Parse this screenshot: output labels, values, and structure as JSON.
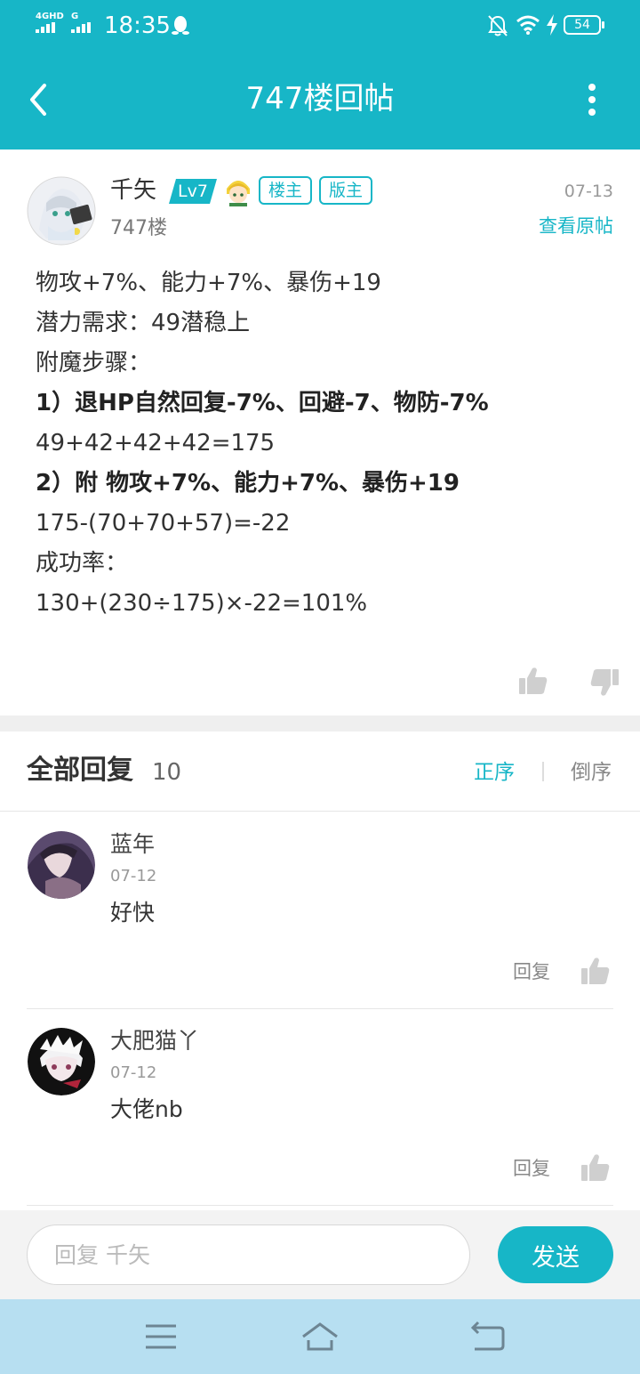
{
  "status_bar": {
    "network_1": "4GHD",
    "network_2": "G",
    "time": "18:35",
    "battery": "54"
  },
  "app_bar": {
    "title": "747楼回帖",
    "back_icon": "chevron-left-icon",
    "more_icon": "more-vertical-icon"
  },
  "post": {
    "author": "千矢",
    "level": "Lv7",
    "tags": [
      "楼主",
      "版主"
    ],
    "floor": "747楼",
    "date": "07-13",
    "view_original": "查看原帖",
    "lines": [
      "物攻+7%、能力+7%、暴伤+19",
      "潜力需求：49潜稳上",
      "附魔步骤：",
      "1）退HP自然回复-7%、回避-7、物防-7%",
      "49+42+42+42=175",
      "2）附 物攻+7%、能力+7%、暴伤+19",
      "175-(70+70+57)=-22",
      "成功率：",
      "130+(230÷175)×-22=101%"
    ]
  },
  "replies_header": {
    "title": "全部回复",
    "count": "10",
    "sort_asc": "正序",
    "sort_desc": "倒序"
  },
  "replies": [
    {
      "name": "蓝年",
      "date": "07-12",
      "text": "好快",
      "reply_label": "回复"
    },
    {
      "name": "大肥猫丫",
      "date": "07-12",
      "text": "大佬nb",
      "reply_label": "回复"
    }
  ],
  "input_bar": {
    "placeholder": "回复 千矢",
    "send_label": "发送"
  },
  "colors": {
    "accent": "#17b6c7",
    "nav_bar": "#b7dff1"
  }
}
